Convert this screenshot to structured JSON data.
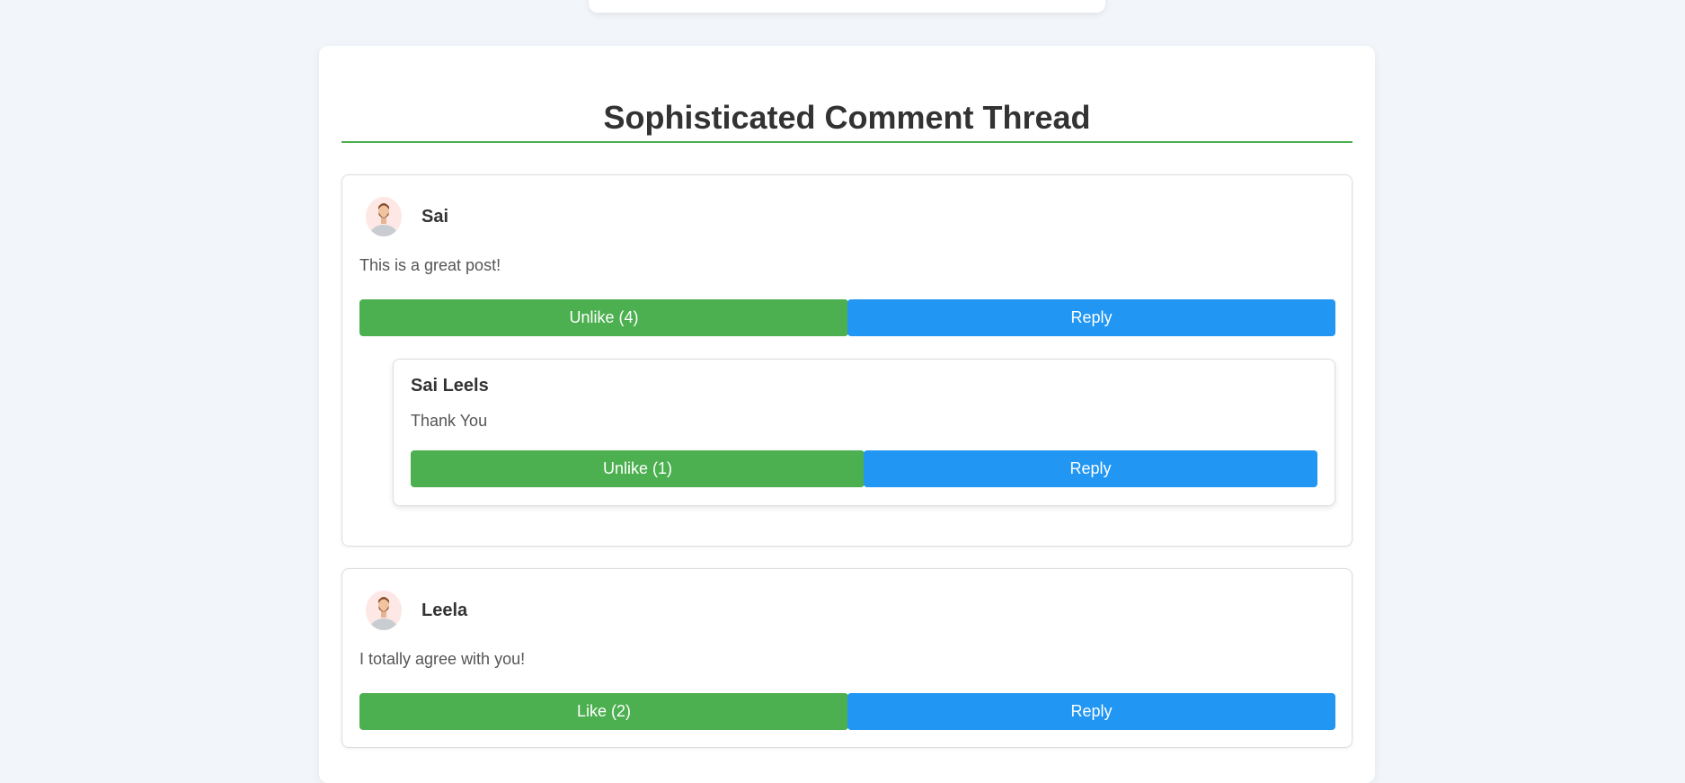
{
  "heading": "Sophisticated Comment Thread",
  "colors": {
    "accent": "#4caf50",
    "reply": "#2196f3",
    "background": "#f2f5fa"
  },
  "comments": [
    {
      "author": "Sai",
      "avatar_icon": "user-avatar-icon",
      "text": "This is a great post!",
      "like_label": "Unlike (4)",
      "reply_label": "Reply",
      "replies": [
        {
          "author": "Sai Leels",
          "text": "Thank You",
          "like_label": "Unlike (1)",
          "reply_label": "Reply"
        }
      ]
    },
    {
      "author": "Leela",
      "avatar_icon": "user-avatar-icon",
      "text": "I totally agree with you!",
      "like_label": "Like (2)",
      "reply_label": "Reply",
      "replies": []
    }
  ]
}
